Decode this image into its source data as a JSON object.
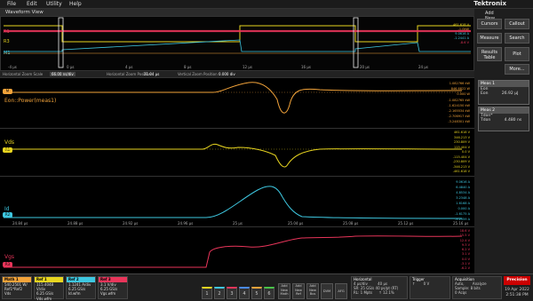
{
  "menu": {
    "file": "File",
    "edit": "Edit",
    "utility": "Utility",
    "help": "Help"
  },
  "brand": "Tektronix",
  "add_new": "Add New...",
  "window_title": "Waveform View",
  "overview": {
    "labels": {
      "ref1": "R1",
      "math": "M1",
      "ref3": "R3"
    },
    "time_ticks": [
      "-4 µs",
      "0 µs",
      "4 µs",
      "8 µs",
      "12 µs",
      "16 µs",
      "20 µs",
      "24 µs",
      "28 µs"
    ],
    "right_vals": {
      "a": "461.618 V",
      "b": "-1.0kW",
      "c": "9.0616 A",
      "d": "-1.2441 A",
      "e": "-8.6 V"
    }
  },
  "horizontal_bar": {
    "label": "Horizontal Zoom Scale",
    "scale": "66.00 ns/div",
    "pos_label": "Horizontal Zoom Position",
    "pos": "21.04 µs",
    "vpos_label": "Vertical Zoom Position",
    "vpos": "0.000 div"
  },
  "panels": {
    "power": {
      "marker": "M",
      "label": "Eon::Power(meas1)",
      "vals": [
        "1.082766 kW",
        "846.6822 W",
        "0.000 W",
        "-1.082765 kW",
        "-1.624150 kW",
        "-2.165534 kW",
        "-2.706917 kW",
        "-3.248301 kW"
      ]
    },
    "vds": {
      "marker": "R1",
      "label": "Vds",
      "vals": [
        "461.618 V",
        "346.213 V",
        "230.809 V",
        "115.404 V",
        "0.0 V",
        "-115.404 V",
        "-230.809 V",
        "-346.213 V",
        "-461.618 V"
      ]
    },
    "id": {
      "marker": "R2",
      "label": "Id",
      "vals": [
        "9.0616 A",
        "6.4840 A",
        "4.8534 A",
        "3.2348 A",
        "1.6168 A",
        "0.000 A",
        "-1.6175 A",
        "-3.2359 A"
      ]
    },
    "vgs": {
      "marker": "R3",
      "label": "Vgs",
      "vals": [
        "18.6 V",
        "15.5 V",
        "12.4 V",
        "9.3 V",
        "6.2 V",
        "3.1 V",
        "0.0 V",
        "-3.1 V",
        "-6.2 V"
      ]
    }
  },
  "zoom_ticks": [
    "24.84 µs",
    "24.88 µs",
    "24.92 µs",
    "24.96 µs",
    "25 µs",
    "25.04 µs",
    "25.08 µs",
    "25.12 µs",
    "25.16 µs"
  ],
  "side": {
    "cursors": "Cursors",
    "callout": "Callout",
    "measure": "Measure",
    "search": "Search",
    "results_table": "Results Table",
    "plot": "Plot",
    "more": "More...",
    "meas1": {
      "title": "Meas 1",
      "l1": "Eon",
      "l2": "Eon",
      "v2": "26.92 µJ"
    },
    "meas2": {
      "title": "Meas 2",
      "l1": "Tdon*",
      "l2": "Tdon",
      "v2": "4.480 ns"
    }
  },
  "bottom": {
    "math1": {
      "title": "Math 1",
      "l1": "540.2501 W/",
      "l2": "Ref1*Ref2",
      "l3": "Vds"
    },
    "ref1": {
      "title": "Ref 1",
      "l1": "115.4048 V/div",
      "l2": "6.25 GS/s",
      "l3": "Vds.wfm"
    },
    "ref2": {
      "title": "Ref 2",
      "l1": "1.1241 A/div",
      "l2": "6.25 GS/s",
      "l3": "Id.wfm"
    },
    "ref3": {
      "title": "Ref 3",
      "l1": "3.1 V/div",
      "l2": "6.25 GS/s",
      "l3": "Vgs.wfm"
    },
    "channels": [
      "1",
      "2",
      "3",
      "4",
      "5",
      "6"
    ],
    "add": [
      "Add New Math",
      "Add New Ref",
      "Add New Bus"
    ],
    "dvm": "DVM",
    "afg": "AFG",
    "horizontal": {
      "title": "Horizontal",
      "l1": "4 µs/div",
      "l1b": "40 µs",
      "l2": "SR: 25 GS/s",
      "l2b": "40 ps/pt (RT)",
      "l3": "RL: 1 Mpts",
      "l3b": "↑ 12.1%"
    },
    "trigger": {
      "title": "Trigger",
      "l1": "↑",
      "l1b": "0 V"
    },
    "acquisition": {
      "title": "Acquisition",
      "l1": "Auto,",
      "l1b": "Analyze",
      "l2": "Sample: 8 bits",
      "l3": "0 Acqs"
    },
    "precision": "Precision",
    "date": "19 Apr 2022",
    "time": "2:51:38 PM"
  },
  "colors": {
    "power": "#f2a33a",
    "vds": "#e8d520",
    "id": "#3ec7e0",
    "vgs": "#e8355a",
    "badge_math": "#f2a33a",
    "badge_ref1": "#e8d520",
    "badge_ref2": "#3ec7e0",
    "badge_ref3": "#e8355a"
  }
}
